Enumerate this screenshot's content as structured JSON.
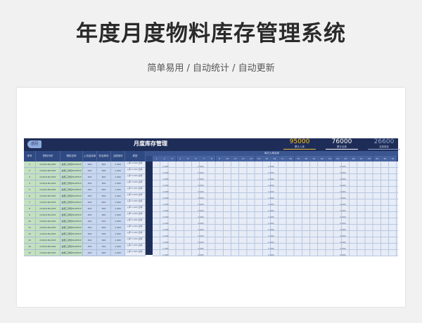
{
  "page": {
    "title": "年度月度物料库存管理系统",
    "subtitle": "简单易用 / 自动统计 / 自动更新"
  },
  "sheet": {
    "back_label": "返回",
    "title": "月度库存管理",
    "daily_header": "每日入库出库",
    "stats": [
      {
        "value": "95000",
        "label": "累计入库",
        "color": "#f0c040"
      },
      {
        "value": "76000",
        "label": "累计出库",
        "color": "#ffffff"
      },
      {
        "value": "26600",
        "label": "当前库存",
        "color": "#8fa5d0"
      }
    ],
    "columns": [
      "序号",
      "物料代码",
      "物料名称",
      "上月结余库存",
      "安全库存",
      "当前库存",
      "类型"
    ],
    "days": [
      "1",
      "2",
      "3",
      "4",
      "5",
      "6",
      "7",
      "8",
      "9",
      "10",
      "11",
      "12",
      "13",
      "14",
      "15",
      "16",
      "17",
      "18",
      "19",
      "20",
      "21",
      "22",
      "23",
      "24",
      "25",
      "26",
      "27",
      "28",
      "29",
      "30",
      "31"
    ],
    "io_labels": {
      "in": "入库",
      "out": "出库"
    },
    "rows": [
      {
        "no": "1",
        "code": "0120/0-BL2003",
        "name": "金属三通管ZGWH1P",
        "prev": "400",
        "safe": "600",
        "cur": "1,400",
        "in_total": "5,000",
        "out_total": "1,000"
      },
      {
        "no": "2",
        "code": "0120/0-BL2003",
        "name": "金属三通管ZGWH1P",
        "prev": "400",
        "safe": "500",
        "cur": "1,400",
        "in_total": "5,000",
        "out_total": "1,000"
      },
      {
        "no": "3",
        "code": "0120/0-BL2003",
        "name": "金属三通管ZGWH1P",
        "prev": "400",
        "safe": "600",
        "cur": "1,400",
        "in_total": "5,000",
        "out_total": "1,000"
      },
      {
        "no": "4",
        "code": "0120/0-BL2003",
        "name": "金属三通管ZGWH1P",
        "prev": "400",
        "safe": "500",
        "cur": "1,400",
        "in_total": "5,000",
        "out_total": "1,000"
      },
      {
        "no": "5",
        "code": "0120/0-BL2003",
        "name": "金属三通管ZGWH1P",
        "prev": "400",
        "safe": "600",
        "cur": "1,400",
        "in_total": "5,000",
        "out_total": "1,000"
      },
      {
        "no": "6",
        "code": "0120/0-BL2003",
        "name": "金属三通管ZGWH1P",
        "prev": "400",
        "safe": "500",
        "cur": "1,400",
        "in_total": "5,000",
        "out_total": "1,000"
      },
      {
        "no": "7",
        "code": "0120/0-BL2003",
        "name": "金属三通管ZGWH1P",
        "prev": "400",
        "safe": "600",
        "cur": "1,400",
        "in_total": "5,000",
        "out_total": "1,000"
      },
      {
        "no": "8",
        "code": "0120/0-BL2003",
        "name": "金属三通管ZGWH1P",
        "prev": "400",
        "safe": "500",
        "cur": "1,400",
        "in_total": "5,000",
        "out_total": "1,000"
      },
      {
        "no": "9",
        "code": "0120/0-BL2003",
        "name": "金属三通管ZGWH1P",
        "prev": "400",
        "safe": "600",
        "cur": "1,400",
        "in_total": "5,000",
        "out_total": "1,000"
      },
      {
        "no": "10",
        "code": "0120/0-BL2003",
        "name": "金属三通管ZGWH1P",
        "prev": "400",
        "safe": "500",
        "cur": "1,400",
        "in_total": "5,000",
        "out_total": "1,000"
      },
      {
        "no": "11",
        "code": "0120/0-BL2003",
        "name": "金属三通管ZGWH1P",
        "prev": "400",
        "safe": "600",
        "cur": "1,400",
        "in_total": "5,000",
        "out_total": "1,000"
      },
      {
        "no": "12",
        "code": "0120/0-BL2003",
        "name": "金属三通管ZGWH1P",
        "prev": "400",
        "safe": "500",
        "cur": "1,400",
        "in_total": "5,000",
        "out_total": "1,000"
      },
      {
        "no": "13",
        "code": "0120/0-BL2003",
        "name": "金属三通管ZGWH1P",
        "prev": "400",
        "safe": "600",
        "cur": "1,400",
        "in_total": "5,000",
        "out_total": "1,000"
      },
      {
        "no": "14",
        "code": "0120/0-BL2003",
        "name": "金属三通管ZGWH1P",
        "prev": "400",
        "safe": "500",
        "cur": "1,400",
        "in_total": "5,000",
        "out_total": "1,000"
      },
      {
        "no": "15",
        "code": "0120/0-BL2003",
        "name": "金属三通管ZGWH1P",
        "prev": "400",
        "safe": "600",
        "cur": "1,400",
        "in_total": "5,000",
        "out_total": "1,000"
      }
    ],
    "daily_values": {
      "day3": "1,000",
      "day8": "1,000",
      "day19": "1,000",
      "day29": "1,000"
    }
  }
}
